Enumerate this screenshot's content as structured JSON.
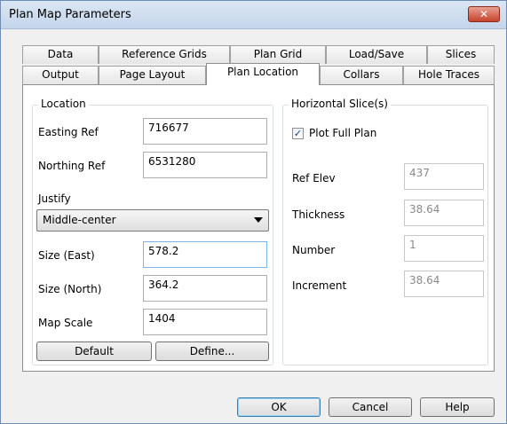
{
  "window": {
    "title": "Plan Map Parameters",
    "close_glyph": "✕"
  },
  "tabs_row1": [
    {
      "label": "Data"
    },
    {
      "label": "Reference Grids"
    },
    {
      "label": "Plan Grid"
    },
    {
      "label": "Load/Save"
    },
    {
      "label": "Slices"
    }
  ],
  "tabs_row2": [
    {
      "label": "Output"
    },
    {
      "label": "Page Layout"
    },
    {
      "label": "Plan Location",
      "active": true
    },
    {
      "label": "Collars"
    },
    {
      "label": "Hole Traces"
    }
  ],
  "location": {
    "group_title": "Location",
    "easting_label": "Easting Ref",
    "easting_value": "716677",
    "northing_label": "Northing Ref",
    "northing_value": "6531280",
    "justify_label": "Justify",
    "justify_value": "Middle-center",
    "size_east_label": "Size (East)",
    "size_east_value": "578.2",
    "size_north_label": "Size (North)",
    "size_north_value": "364.2",
    "map_scale_label": "Map Scale",
    "map_scale_value": "1404",
    "default_button": "Default",
    "define_button": "Define..."
  },
  "slices": {
    "group_title": "Horizontal Slice(s)",
    "plot_full_plan_label": "Plot Full Plan",
    "plot_full_plan_checked": true,
    "ref_elev_label": "Ref Elev",
    "ref_elev_value": "437",
    "thickness_label": "Thickness",
    "thickness_value": "38.64",
    "number_label": "Number",
    "number_value": "1",
    "increment_label": "Increment",
    "increment_value": "38.64"
  },
  "footer": {
    "ok": "OK",
    "cancel": "Cancel",
    "help": "Help"
  },
  "colors": {
    "titlebar": "#c4d5ea",
    "close": "#c7432c",
    "focus_border": "#7eb4ea"
  }
}
